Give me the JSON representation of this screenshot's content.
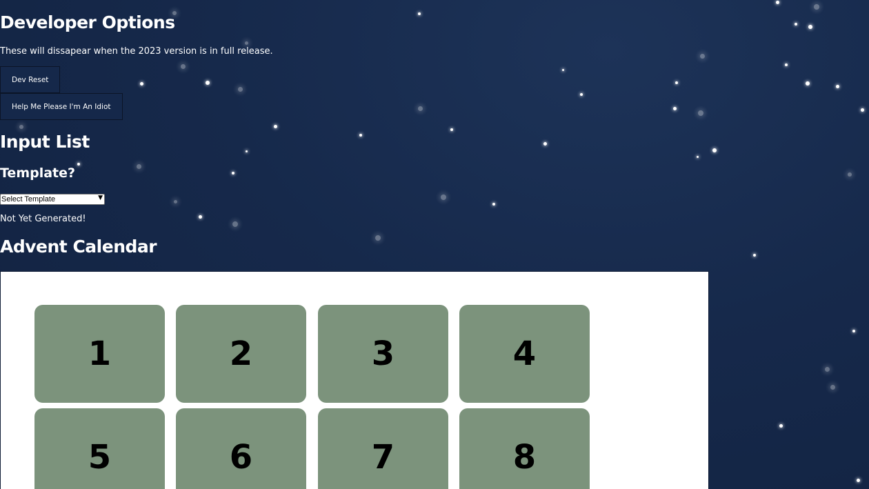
{
  "developer_options": {
    "title": "Developer Options",
    "note": "These will dissapear when the 2023 version is in full release.",
    "dev_reset_label": "Dev Reset",
    "help_label": "Help Me Please I'm An Idiot"
  },
  "input_list": {
    "title": "Input List",
    "template_heading": "Template?",
    "template_select": {
      "selected": "Select Template",
      "options": [
        "Select Template"
      ]
    },
    "status": "Not Yet Generated!"
  },
  "advent_calendar": {
    "title": "Advent Calendar",
    "doors": [
      "1",
      "2",
      "3",
      "4",
      "5",
      "6",
      "7",
      "8"
    ]
  },
  "colors": {
    "background": "#16294b",
    "door": "#7c937c",
    "button": "#15284a"
  }
}
